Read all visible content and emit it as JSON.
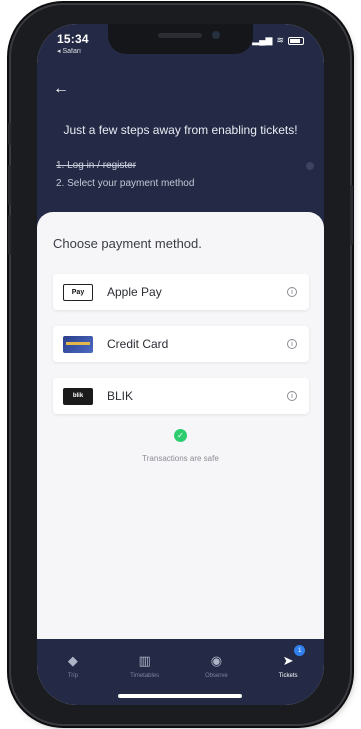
{
  "status_bar": {
    "time": "15:34",
    "back_app": "◂ Safari",
    "signal": "▂▄▆",
    "wifi": "≋"
  },
  "header": {
    "back_icon": "arrow-left",
    "headline": "Just a few steps away from enabling tickets!",
    "step1": "1. Log in / register",
    "step2": "2. Select your payment method"
  },
  "main": {
    "choose_label": "Choose payment method.",
    "methods": [
      {
        "label": "Apple Pay",
        "icon_text": "Pay",
        "icon": "apple-pay-icon"
      },
      {
        "label": "Credit Card",
        "icon_text": "",
        "icon": "credit-card-icon"
      },
      {
        "label": "BLIK",
        "icon_text": "blik",
        "icon": "blik-icon"
      }
    ],
    "info_glyph": "i",
    "secure_glyph": "✓",
    "secure_text": "Transactions are safe"
  },
  "tabbar": {
    "tabs": [
      {
        "label": "Trip",
        "glyph": "◆"
      },
      {
        "label": "Timetables",
        "glyph": "▥"
      },
      {
        "label": "Observe",
        "glyph": "◉"
      },
      {
        "label": "Tickets",
        "glyph": "➤",
        "badge": "1"
      }
    ]
  },
  "colors": {
    "header_bg": "#242a45",
    "tabbar_bg": "#242a45",
    "secure_green": "#2ecc71",
    "badge_blue": "#2f80ed"
  }
}
